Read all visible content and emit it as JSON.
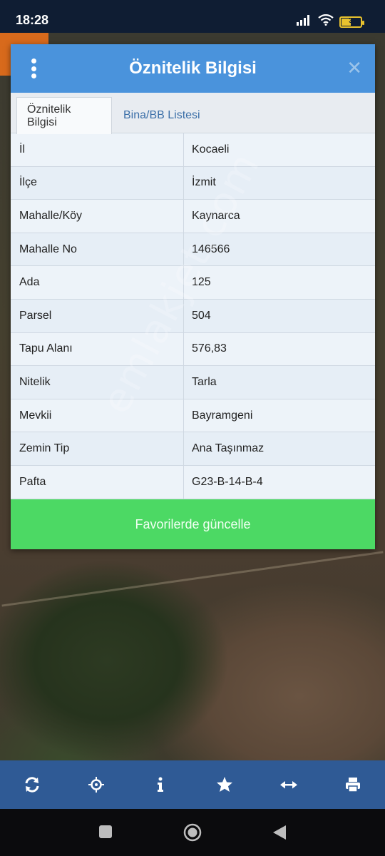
{
  "status_bar": {
    "time": "18:28",
    "battery_level": "3",
    "icons": [
      "signal-icon",
      "wifi-icon",
      "battery-icon"
    ]
  },
  "dialog": {
    "title": "Öznitelik Bilgisi",
    "tabs": [
      {
        "label": "Öznitelik Bilgisi",
        "active": true
      },
      {
        "label": "Bina/BB Listesi",
        "active": false
      }
    ],
    "rows": [
      {
        "key": "İl",
        "value": "Kocaeli"
      },
      {
        "key": "İlçe",
        "value": "İzmit"
      },
      {
        "key": "Mahalle/Köy",
        "value": "Kaynarca"
      },
      {
        "key": "Mahalle No",
        "value": "146566"
      },
      {
        "key": "Ada",
        "value": "125"
      },
      {
        "key": "Parsel",
        "value": "504"
      },
      {
        "key": "Tapu Alanı",
        "value": "576,83"
      },
      {
        "key": "Nitelik",
        "value": "Tarla"
      },
      {
        "key": "Mevkii",
        "value": "Bayramgeni"
      },
      {
        "key": "Zemin Tip",
        "value": "Ana Taşınmaz"
      },
      {
        "key": "Pafta",
        "value": "G23-B-14-B-4"
      }
    ],
    "update_button": "Favorilerde güncelle"
  },
  "watermark": "emlakjet.com",
  "toolbar": [
    "refresh-icon",
    "locate-icon",
    "info-icon",
    "star-icon",
    "measure-icon",
    "print-icon"
  ],
  "colors": {
    "header": "#4a93dc",
    "update_button": "#4cd964",
    "toolbar": "#2f5a95"
  }
}
